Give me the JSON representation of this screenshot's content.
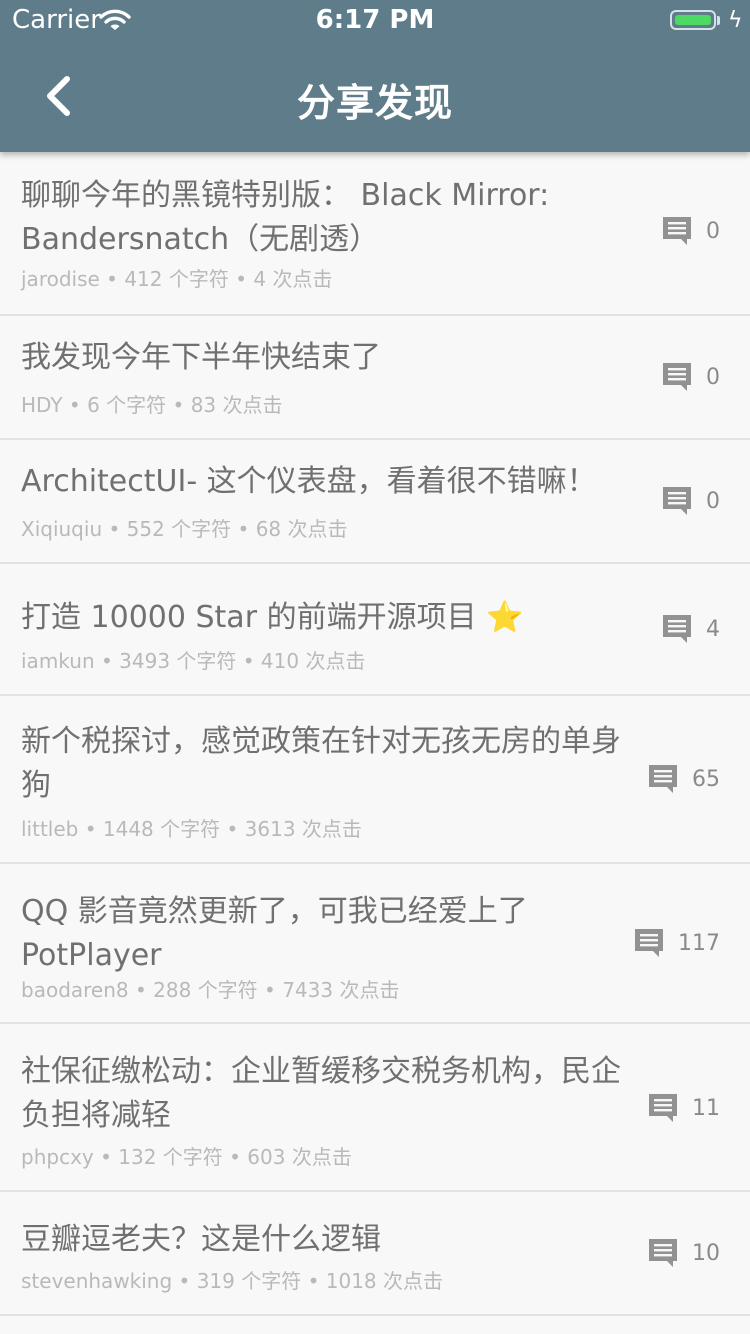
{
  "status_bar": {
    "carrier": "Carrier",
    "time": "6:17 PM"
  },
  "nav": {
    "title": "分享发现",
    "back_icon": "chevron-left-icon"
  },
  "colors": {
    "nav_bg": "#5f7c8a",
    "battery": "#4cd964",
    "text": "#707070",
    "meta": "#b9b9b9"
  },
  "items": [
    {
      "title": "聊聊今年的黑镜特别版： Black Mirror: Bandersnatch（无剧透）",
      "author": "jarodise",
      "chars": "412 个字符",
      "clicks": "4 次点击",
      "comments": "0"
    },
    {
      "title": "我发现今年下半年快结束了",
      "author": "HDY",
      "chars": "6 个字符",
      "clicks": "83 次点击",
      "comments": "0"
    },
    {
      "title": "ArchitectUI- 这个仪表盘，看着很不错嘛！",
      "author": "Xiqiuqiu",
      "chars": "552 个字符",
      "clicks": "68 次点击",
      "comments": "0"
    },
    {
      "title": "打造 10000 Star 的前端开源项目",
      "title_emoji": "⭐",
      "author": "iamkun",
      "chars": "3493 个字符",
      "clicks": "410 次点击",
      "comments": "4"
    },
    {
      "title": "新个税探讨，感觉政策在针对无孩无房的单身狗",
      "author": "littleb",
      "chars": "1448 个字符",
      "clicks": "3613 次点击",
      "comments": "65"
    },
    {
      "title": "QQ 影音竟然更新了，可我已经爱上了 PotPlayer",
      "author": "baodaren8",
      "chars": "288 个字符",
      "clicks": "7433 次点击",
      "comments": "117"
    },
    {
      "title": "社保征缴松动：企业暂缓移交税务机构，民企负担将减轻",
      "author": "phpcxy",
      "chars": "132 个字符",
      "clicks": "603 次点击",
      "comments": "11"
    },
    {
      "title": "豆瓣逗老夫？这是什么逻辑",
      "author": "stevenhawking",
      "chars": "319 个字符",
      "clicks": "1018 次点击",
      "comments": "10"
    }
  ]
}
